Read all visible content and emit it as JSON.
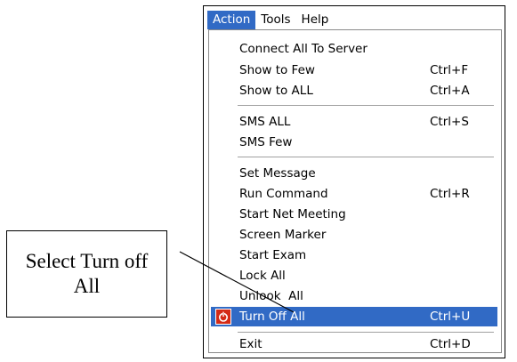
{
  "menubar": {
    "items": [
      {
        "label": "Action",
        "active": true
      },
      {
        "label": "Tools",
        "active": false
      },
      {
        "label": "Help",
        "active": false
      }
    ]
  },
  "action_menu": {
    "items": [
      {
        "label": "Connect All To Server",
        "shortcut": ""
      },
      {
        "label": "Show to Few",
        "shortcut": "Ctrl+F"
      },
      {
        "label": "Show to ALL",
        "shortcut": "Ctrl+A"
      },
      {
        "label": "SMS ALL",
        "shortcut": "Ctrl+S"
      },
      {
        "label": "SMS Few",
        "shortcut": ""
      },
      {
        "label": "Set Message",
        "shortcut": ""
      },
      {
        "label": "Run Command",
        "shortcut": "Ctrl+R"
      },
      {
        "label": "Start Net Meeting",
        "shortcut": ""
      },
      {
        "label": "Screen Marker",
        "shortcut": ""
      },
      {
        "label": "Start Exam",
        "shortcut": ""
      },
      {
        "label": "Lock All",
        "shortcut": ""
      },
      {
        "label": "Unlook  All",
        "shortcut": ""
      },
      {
        "label": "Turn Off All",
        "shortcut": "Ctrl+U",
        "highlighted": true,
        "icon": "power-icon"
      },
      {
        "label": "Exit",
        "shortcut": "Ctrl+D"
      }
    ]
  },
  "callout": {
    "text": "Select Turn off All"
  },
  "colors": {
    "highlight": "#316ac5",
    "power_icon": "#d42a16"
  }
}
